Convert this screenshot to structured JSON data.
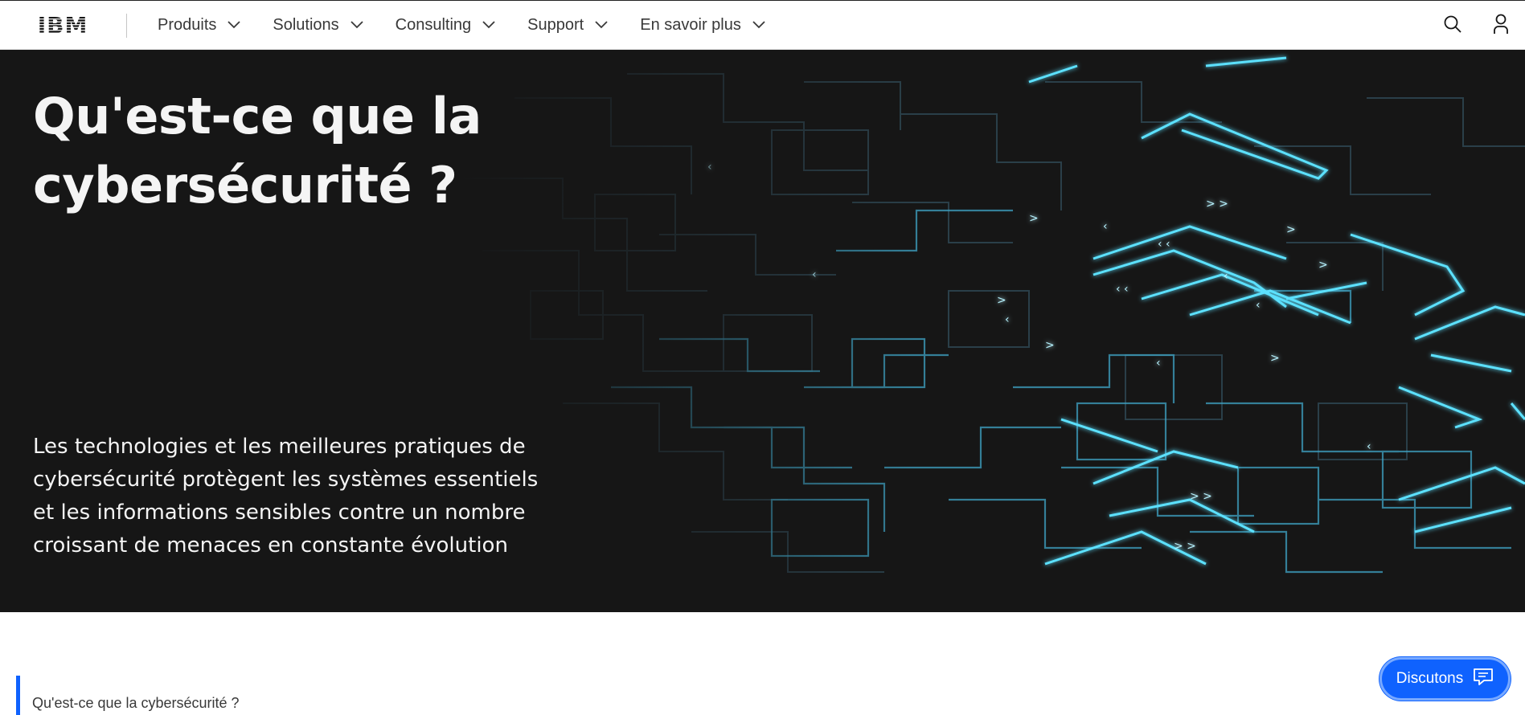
{
  "brand": {
    "logo_text": "IBM"
  },
  "nav": {
    "items": [
      {
        "label": "Produits"
      },
      {
        "label": "Solutions"
      },
      {
        "label": "Consulting"
      },
      {
        "label": "Support"
      },
      {
        "label": "En savoir plus"
      }
    ],
    "icons": {
      "search": "search-icon",
      "user": "user-icon",
      "chevron": "chevron-down-icon"
    }
  },
  "hero": {
    "title": "Qu'est-ce que la cybersécurité ?",
    "description": "Les technologies et les meilleures pratiques de cybersécurité protègent les systèmes essentiels et les informations sensibles contre un nombre croissant de menaces en constante évolution"
  },
  "toc": {
    "first_item": "Qu'est-ce que la cybersécurité ?"
  },
  "chat": {
    "label": "Discutons",
    "icon": "chat-icon"
  },
  "colors": {
    "accent": "#0f62fe",
    "hero_bg": "#161616",
    "circuit_glow": "#4fd6ff",
    "text_dark": "#393939"
  }
}
